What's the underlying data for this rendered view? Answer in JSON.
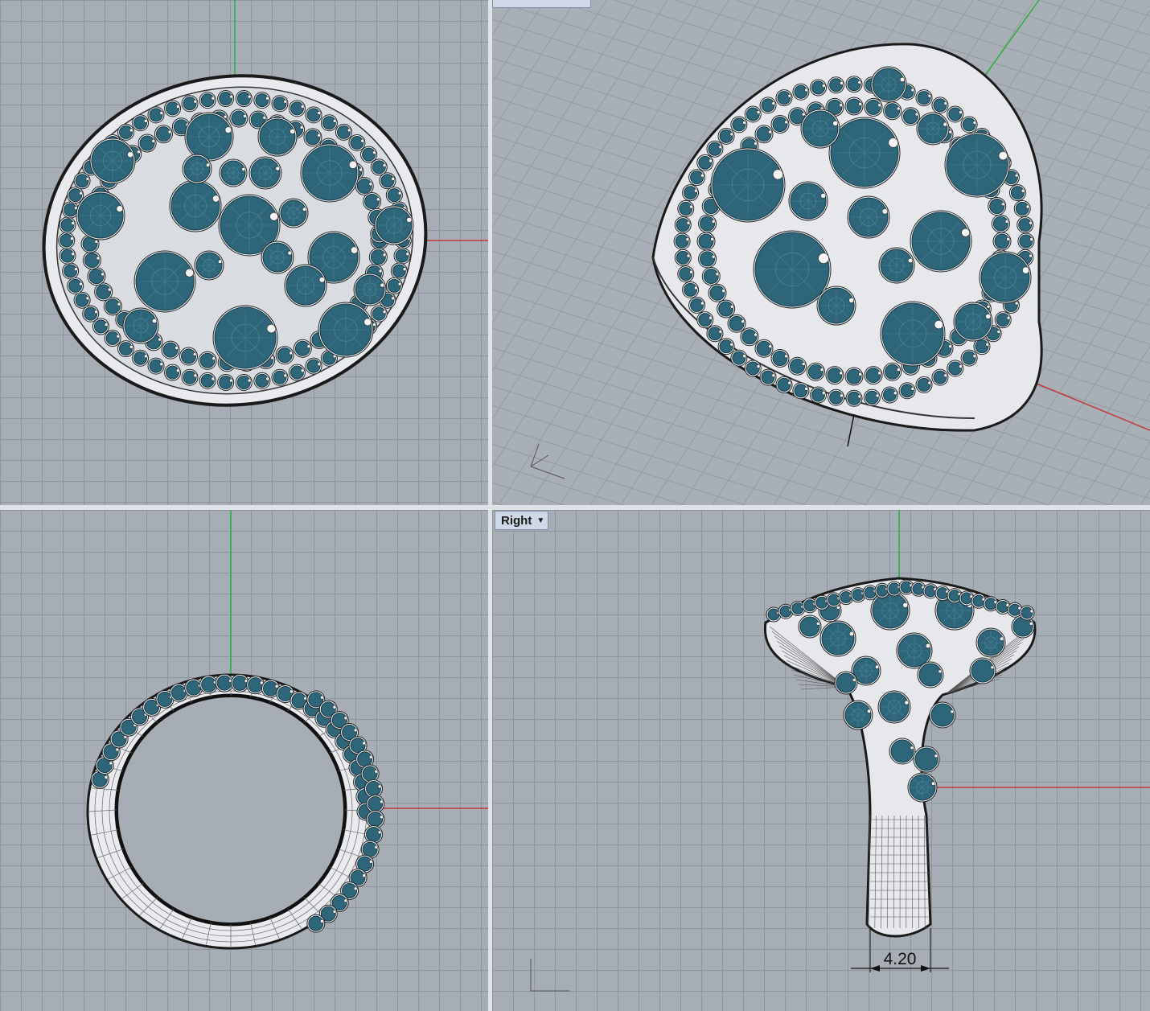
{
  "viewports": {
    "right": {
      "label": "Right",
      "menu_icon": "dropdown-arrow-icon"
    }
  },
  "dimension": {
    "value": "4.20"
  },
  "colors": {
    "background": "#a7adb4",
    "grid": "#8f959c",
    "gem": "#2f6579",
    "metal": "#eef0f2",
    "x_axis": "#c23a3a",
    "y_axis": "#2fae3e",
    "divider": "#e4e8ee"
  }
}
